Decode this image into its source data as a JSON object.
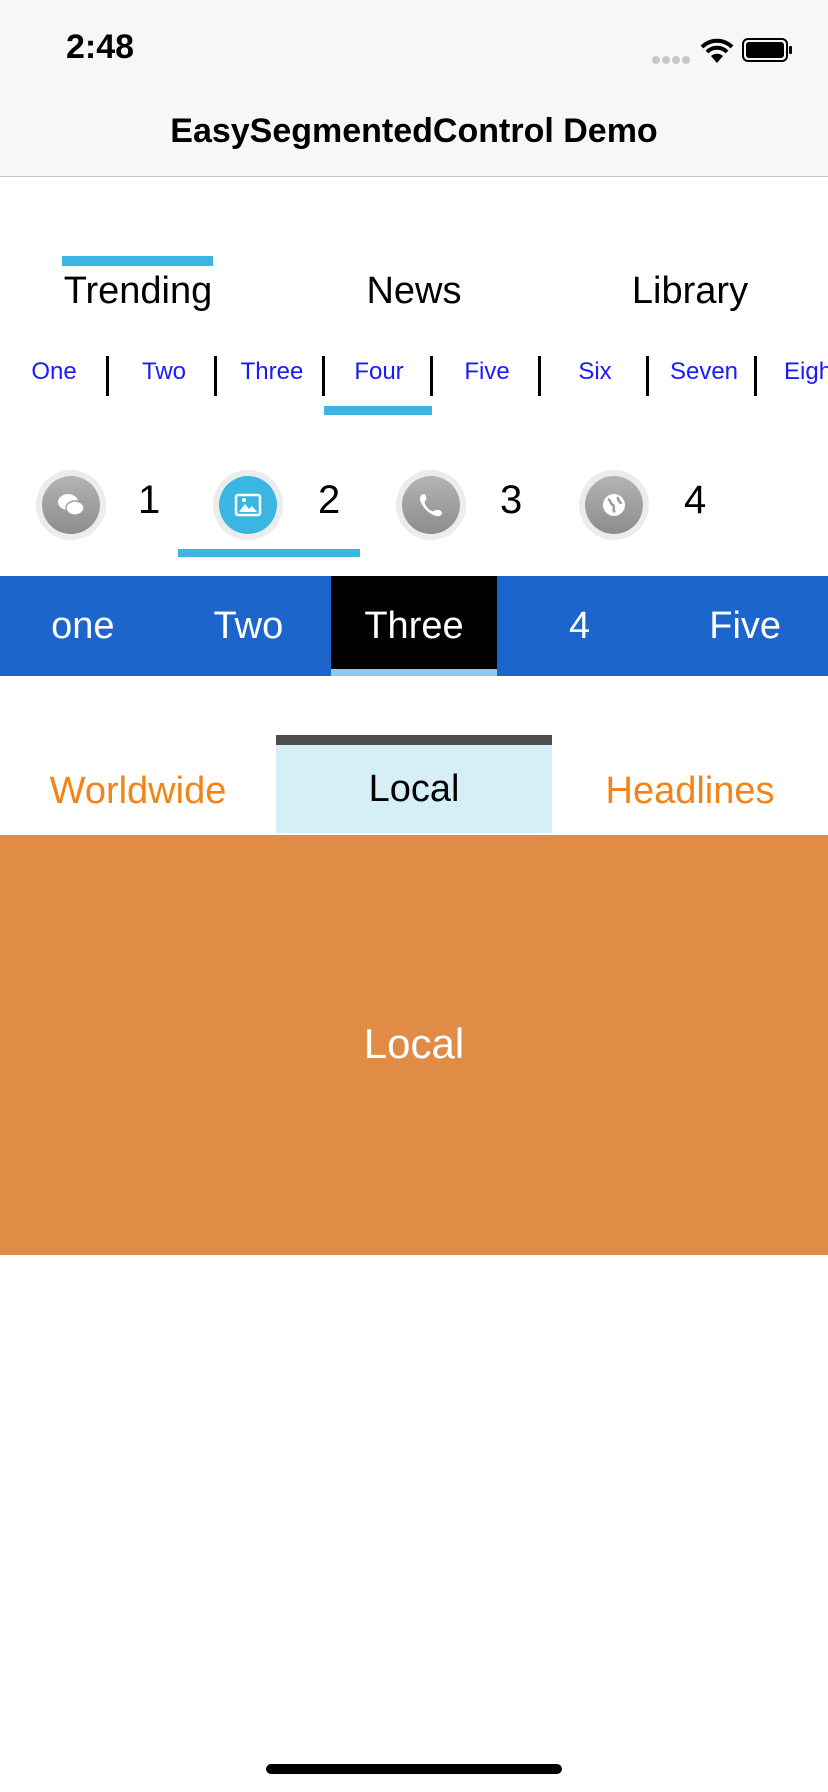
{
  "status_bar": {
    "time": "2:48"
  },
  "nav": {
    "title": "EasySegmentedControl Demo"
  },
  "segment1": {
    "items": [
      "Trending",
      "News",
      "Library"
    ],
    "selected": 0,
    "indicator_color": "#3bb6e3"
  },
  "segment2": {
    "items": [
      "One",
      "Two",
      "Three",
      "Four",
      "Five",
      "Six",
      "Seven",
      "Eigh"
    ],
    "selected": 3,
    "text_color": "#1a1aff"
  },
  "segment3": {
    "items": [
      {
        "icon": "chat-bubbles-icon",
        "label": "1"
      },
      {
        "icon": "image-icon",
        "label": "2"
      },
      {
        "icon": "phone-icon",
        "label": "3"
      },
      {
        "icon": "globe-icon",
        "label": "4"
      }
    ],
    "selected": 1
  },
  "segment4": {
    "items": [
      "one",
      "Two",
      "Three",
      "4",
      "Five"
    ],
    "selected": 2,
    "background": "#1c65cd"
  },
  "segment5": {
    "items": [
      "Worldwide",
      "Local",
      "Headlines"
    ],
    "selected": 1,
    "text_color": "#f28418"
  },
  "content": {
    "label": "Local",
    "background": "#e08c47"
  }
}
